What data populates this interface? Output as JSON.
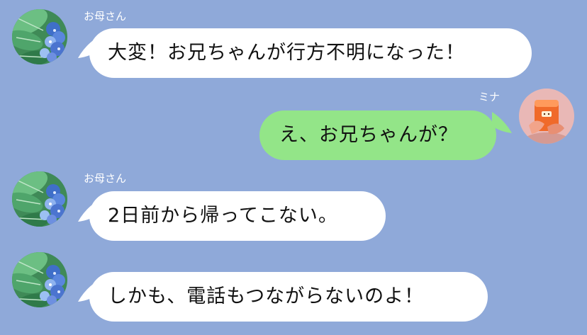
{
  "chat": {
    "colors": {
      "background": "#8fa9d9",
      "incoming_bubble": "#ffffff",
      "outgoing_bubble": "#93e588",
      "name_text": "#ffffff",
      "message_text": "#111111"
    },
    "messages": [
      {
        "sender": "お母さん",
        "direction": "incoming",
        "avatar": "hydrangea-leaf-avatar-icon",
        "text": "大変！お兄ちゃんが行方不明になった！"
      },
      {
        "sender": "ミナ",
        "direction": "outgoing",
        "avatar": "orange-drink-avatar-icon",
        "text": "え、お兄ちゃんが？"
      },
      {
        "sender": "お母さん",
        "direction": "incoming",
        "avatar": "hydrangea-leaf-avatar-icon",
        "text": "2日前から帰ってこない。"
      },
      {
        "sender": "",
        "direction": "incoming",
        "avatar": "hydrangea-leaf-avatar-icon",
        "text": "しかも、電話もつながらないのよ！"
      }
    ]
  }
}
